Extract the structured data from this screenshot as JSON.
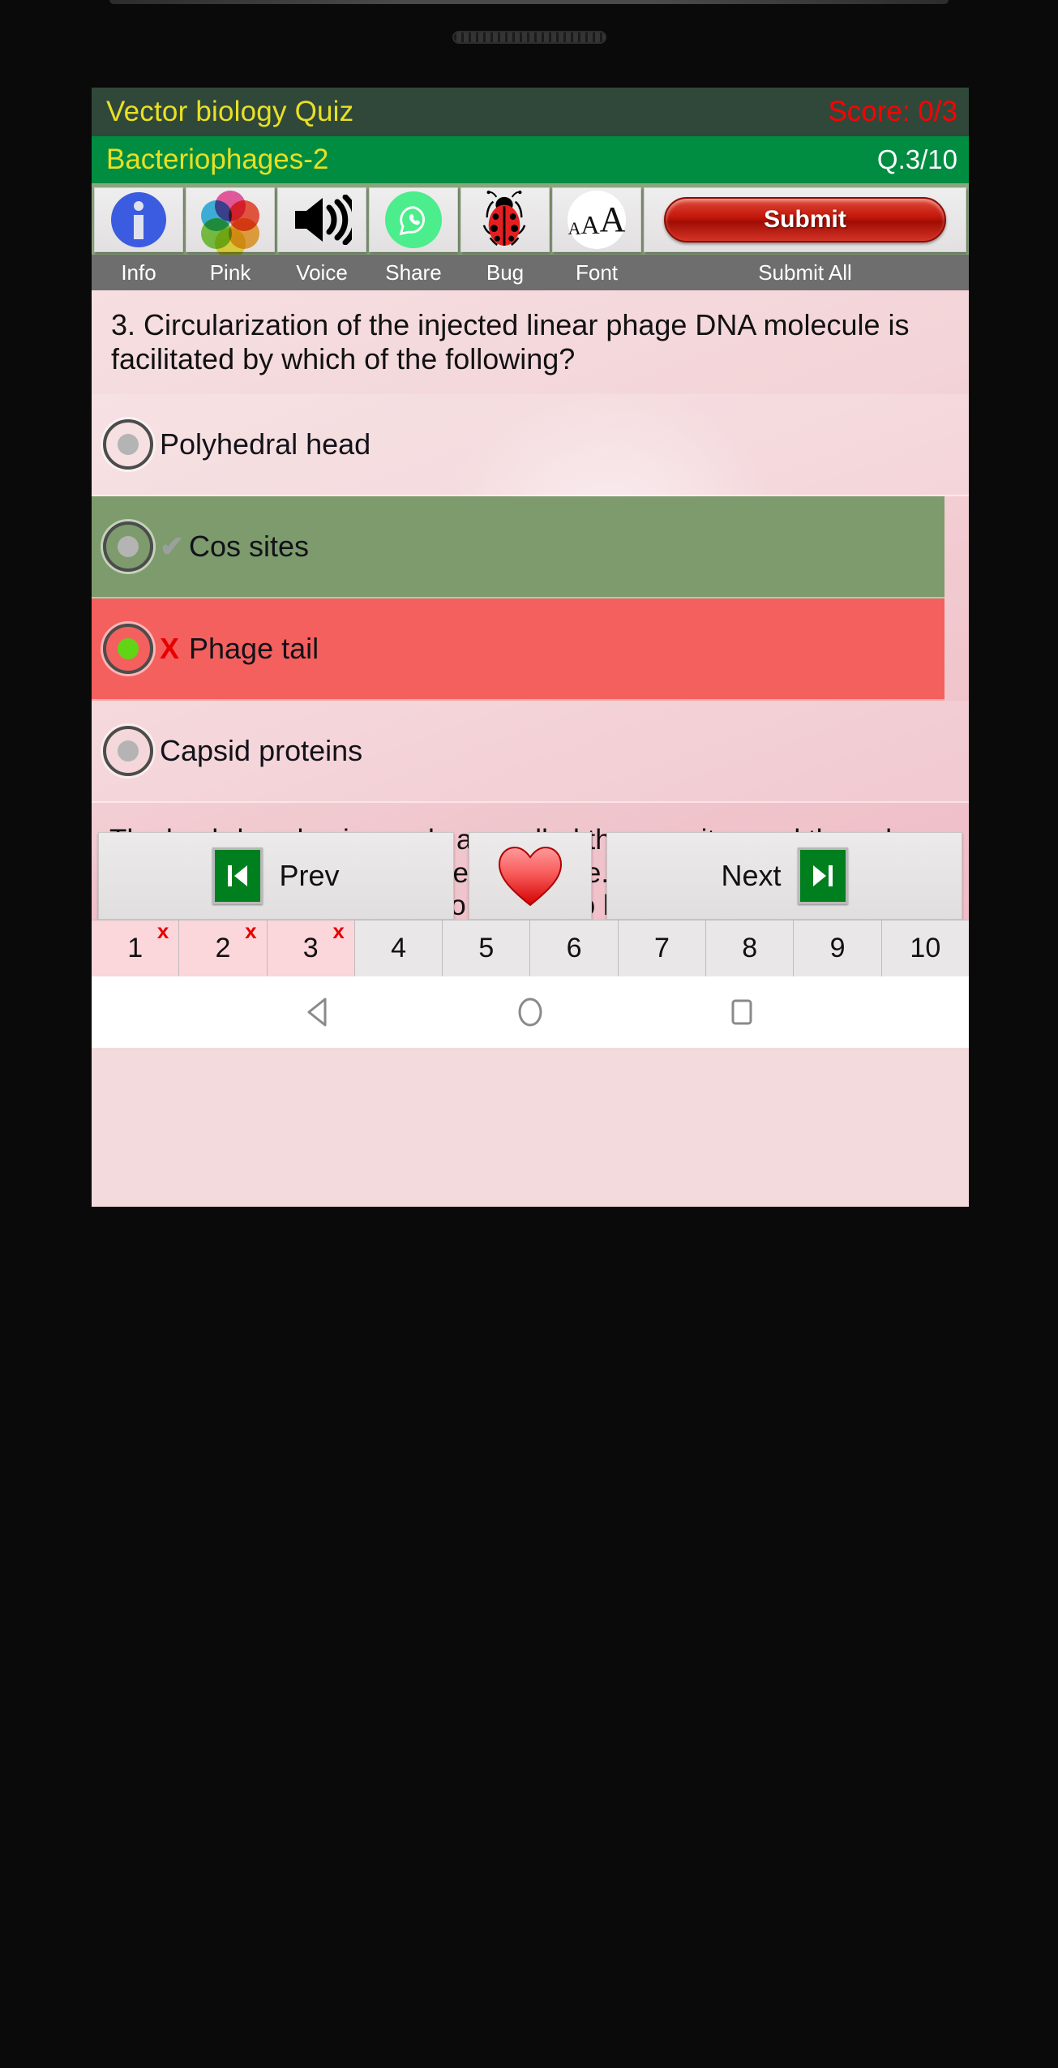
{
  "device": {
    "earpiece": "speaker-grille"
  },
  "header": {
    "quiz_title": "Vector biology Quiz",
    "score_label": "Score: 0/3",
    "subject_title": "Bacteriophages-2",
    "question_counter": "Q.3/10",
    "title_bar_bg": "#30483a",
    "subject_bar_bg": "#018d41",
    "title_color": "#e8e024",
    "score_color": "#ff0000"
  },
  "toolbar": {
    "items": [
      {
        "label": "Info",
        "icon": "info-icon"
      },
      {
        "label": "Pink",
        "icon": "color-wheel-icon"
      },
      {
        "label": "Voice",
        "icon": "speaker-icon"
      },
      {
        "label": "Share",
        "icon": "whatsapp-share-icon"
      },
      {
        "label": "Bug",
        "icon": "ladybug-icon"
      },
      {
        "label": "Font",
        "icon": "font-size-icon"
      },
      {
        "label": "Submit All",
        "icon": "submit-pill-button"
      }
    ],
    "submit_label": "Submit",
    "submit_color": "#c11508"
  },
  "main": {
    "question": "3. Circularization of the injected linear phage DNA molecule is facilitated by which of the following?",
    "options": [
      {
        "label": "Polyhedral head",
        "state": "default",
        "mark": "",
        "selected": false
      },
      {
        "label": "Cos sites",
        "state": "correct",
        "mark": "✔",
        "selected": false
      },
      {
        "label": "Phage tail",
        "state": "wrong",
        "mark": "X",
        "selected": true
      },
      {
        "label": "Capsid proteins",
        "state": "default",
        "mark": "",
        "selected": false
      }
    ],
    "explanation": "The lambda cohesive ends are called the cos sites and they play different roles during the infection cycle. They allow the linear DNA molecule that is injected into the cell to be circularized, which is a necessary prerequisite for insertion into the bacterial genome.",
    "correct_bg": "#7d9b6c",
    "wrong_bg": "#f4605e"
  },
  "nav": {
    "prev_label": "Prev",
    "next_label": "Next",
    "favorite_icon": "heart-icon",
    "prev_icon": "skip-back-icon",
    "next_icon": "skip-forward-icon"
  },
  "pager": {
    "items": [
      {
        "number": "1",
        "mark": "x",
        "answered": true
      },
      {
        "number": "2",
        "mark": "x",
        "answered": true
      },
      {
        "number": "3",
        "mark": "x",
        "answered": true
      },
      {
        "number": "4",
        "mark": "",
        "answered": false
      },
      {
        "number": "5",
        "mark": "",
        "answered": false
      },
      {
        "number": "6",
        "mark": "",
        "answered": false
      },
      {
        "number": "7",
        "mark": "",
        "answered": false
      },
      {
        "number": "8",
        "mark": "",
        "answered": false
      },
      {
        "number": "9",
        "mark": "",
        "answered": false
      },
      {
        "number": "10",
        "mark": "",
        "answered": false
      }
    ]
  },
  "system_nav": {
    "back": "back-triangle-icon",
    "home": "home-circle-icon",
    "recents": "recents-square-icon"
  }
}
